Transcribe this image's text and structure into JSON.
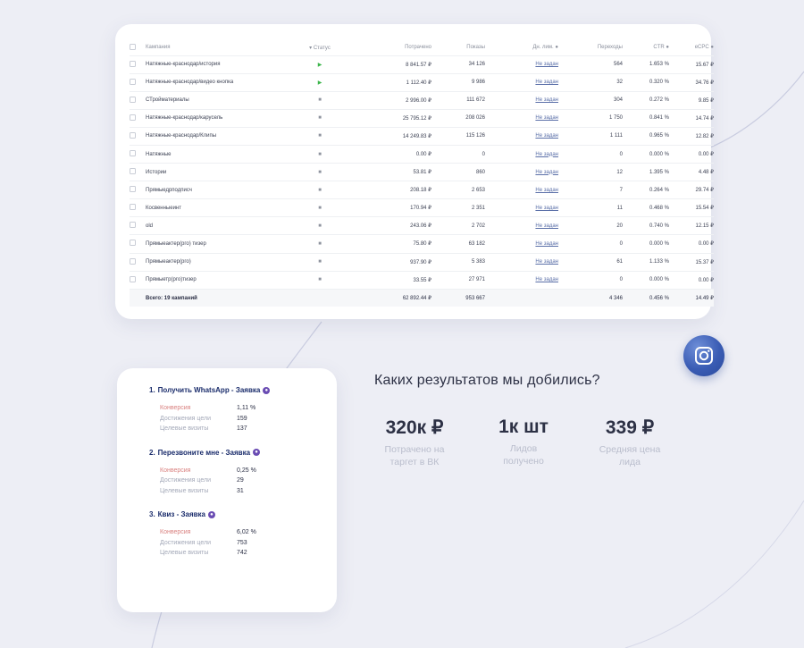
{
  "campaign_table": {
    "headers": {
      "name": "Кампания",
      "status": "▾ Статус",
      "spent": "Потрачено",
      "shows": "Показы",
      "day_limit": "Дн. лим.",
      "clicks": "Переходы",
      "ctr": "CTR",
      "ecpc": "eCPC"
    },
    "rows": [
      {
        "name": "Натяжные-краснодар/история",
        "status": "play",
        "spent": "8 841.57 ₽",
        "shows": "34 126",
        "day_limit": "Не задан",
        "clicks": "564",
        "ctr": "1.653 %",
        "ecpc": "15.67 ₽"
      },
      {
        "name": "Натяжные-краснодар/видео кнопка",
        "status": "play",
        "spent": "1 112.40 ₽",
        "shows": "9 986",
        "day_limit": "Не задан",
        "clicks": "32",
        "ctr": "0.320 %",
        "ecpc": "34.76 ₽"
      },
      {
        "name": "СТройматериалы",
        "status": "pause",
        "spent": "2 996.00 ₽",
        "shows": "111 672",
        "day_limit": "Не задан",
        "clicks": "304",
        "ctr": "0.272 %",
        "ecpc": "9.85 ₽"
      },
      {
        "name": "Натяжные-краснодар/карусель",
        "status": "pause",
        "spent": "25 795.12 ₽",
        "shows": "208 026",
        "day_limit": "Не задан",
        "clicks": "1 750",
        "ctr": "0.841 %",
        "ecpc": "14.74 ₽"
      },
      {
        "name": "Натяжные-краснодар/Клипы",
        "status": "pause",
        "spent": "14 249.83 ₽",
        "shows": "115 126",
        "day_limit": "Не задан",
        "clicks": "1 111",
        "ctr": "0.965 %",
        "ecpc": "12.82 ₽"
      },
      {
        "name": "Натяжные",
        "status": "pause",
        "spent": "0.00 ₽",
        "shows": "0",
        "day_limit": "Не задан",
        "clicks": "0",
        "ctr": "0.000 %",
        "ecpc": "0.00 ₽"
      },
      {
        "name": "Истории",
        "status": "pause",
        "spent": "53.81 ₽",
        "shows": "860",
        "day_limit": "Не задан",
        "clicks": "12",
        "ctr": "1.395 %",
        "ecpc": "4.48 ₽"
      },
      {
        "name": "Прямыедрподписч",
        "status": "pause",
        "spent": "208.18 ₽",
        "shows": "2 653",
        "day_limit": "Не задан",
        "clicks": "7",
        "ctr": "0.264 %",
        "ecpc": "29.74 ₽"
      },
      {
        "name": "Косвенныеинт",
        "status": "pause",
        "spent": "170.94 ₽",
        "shows": "2 351",
        "day_limit": "Не задан",
        "clicks": "11",
        "ctr": "0.468 %",
        "ecpc": "15.54 ₽"
      },
      {
        "name": "old",
        "status": "pause",
        "spent": "243.06 ₽",
        "shows": "2 702",
        "day_limit": "Не задан",
        "clicks": "20",
        "ctr": "0.740 %",
        "ecpc": "12.15 ₽"
      },
      {
        "name": "Прямыеактер(рго) тизер",
        "status": "pause",
        "spent": "75.80 ₽",
        "shows": "63 182",
        "day_limit": "Не задан",
        "clicks": "0",
        "ctr": "0.000 %",
        "ecpc": "0.00 ₽"
      },
      {
        "name": "Прямыеактер(рго)",
        "status": "pause",
        "spent": "937.90 ₽",
        "shows": "5 383",
        "day_limit": "Не задан",
        "clicks": "61",
        "ctr": "1.133 %",
        "ecpc": "15.37 ₽"
      },
      {
        "name": "Прямыетр(рго)тизер",
        "status": "pause",
        "spent": "33.55 ₽",
        "shows": "27 971",
        "day_limit": "Не задан",
        "clicks": "0",
        "ctr": "0.000 %",
        "ecpc": "0.00 ₽"
      }
    ],
    "total": {
      "name": "Всего: 19 кампаний",
      "spent": "62 892.44 ₽",
      "shows": "953 667",
      "clicks": "4 346",
      "ctr": "0.456 %",
      "ecpc": "14.49 ₽"
    }
  },
  "goals": [
    {
      "num": "1.",
      "title": "Получить WhatsApp - Заявка",
      "metrics": [
        {
          "label": "Конверсия",
          "value": "1,11 %"
        },
        {
          "label": "Достижения цели",
          "value": "159"
        },
        {
          "label": "Целевые визиты",
          "value": "137"
        }
      ]
    },
    {
      "num": "2.",
      "title": "Перезвоните мне - Заявка",
      "metrics": [
        {
          "label": "Конверсия",
          "value": "0,25 %"
        },
        {
          "label": "Достижения цели",
          "value": "29"
        },
        {
          "label": "Целевые визиты",
          "value": "31"
        }
      ]
    },
    {
      "num": "3.",
      "title": "Квиз - Заявка",
      "metrics": [
        {
          "label": "Конверсия",
          "value": "6,02 %"
        },
        {
          "label": "Достижения цели",
          "value": "753"
        },
        {
          "label": "Целевые визиты",
          "value": "742"
        }
      ]
    }
  ],
  "results": {
    "title": "Каких результатов мы добились?",
    "stats": [
      {
        "value": "320к ₽",
        "label_line1": "Потрачено на",
        "label_line2": "таргет в ВК"
      },
      {
        "value": "1к шт",
        "label_line1": "Лидов",
        "label_line2": "получено"
      },
      {
        "value": "339 ₽",
        "label_line1": "Средняя цена",
        "label_line2": "лида"
      }
    ]
  },
  "icons": {
    "instagram": "instagram-icon"
  },
  "colors": {
    "background": "#edeef5",
    "accent": "#3a5cb4",
    "goal_title": "#1a2c6b",
    "conversion": "#d9807f",
    "play": "#3bb54a"
  }
}
